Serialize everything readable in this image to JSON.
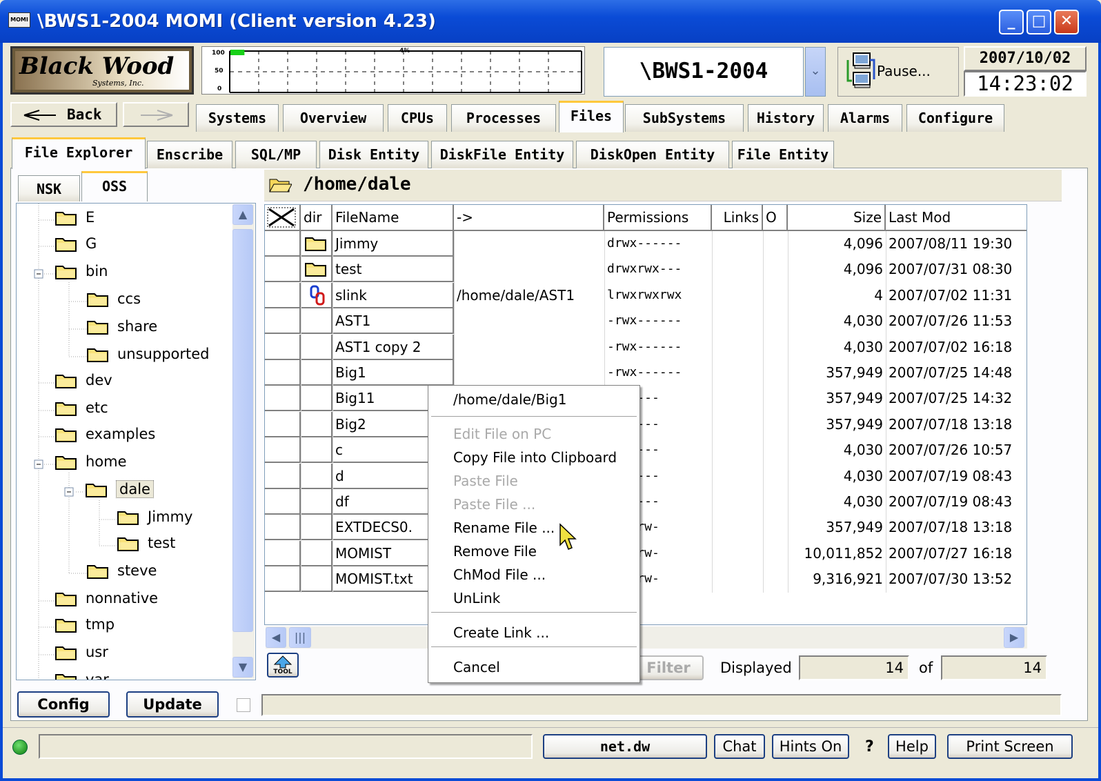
{
  "window": {
    "title": "\\BWS1-2004 MOMI (Client version 4.23)",
    "app_icon": "MOMI"
  },
  "header": {
    "logo_line1": "Black Wood",
    "logo_line2": "Systems, Inc.",
    "graph": {
      "y_ticks": [
        "100",
        "50",
        "0"
      ],
      "percent_label": "4%",
      "progress": 0.04
    },
    "system": "\\BWS1-2004",
    "pause_label": "Pause...",
    "date": "2007/10/02",
    "time": "14:23:02"
  },
  "nav": {
    "back": "Back",
    "tabs": [
      "Systems",
      "Overview",
      "CPUs",
      "Processes",
      "Files",
      "SubSystems",
      "History",
      "Alarms",
      "Configure"
    ],
    "selected_tab": "Files"
  },
  "subtabs": {
    "items": [
      "File Explorer",
      "Enscribe",
      "SQL/MP",
      "Disk Entity",
      "DiskFile Entity",
      "DiskOpen Entity",
      "File Entity"
    ],
    "selected": "File Explorer"
  },
  "tree": {
    "tabs": [
      "NSK",
      "OSS"
    ],
    "selected": "OSS",
    "nodes": [
      "E",
      "G",
      "bin",
      "ccs",
      "share",
      "unsupported",
      "dev",
      "etc",
      "examples",
      "home",
      "dale",
      "Jimmy",
      "test",
      "steve",
      "nonnative",
      "tmp",
      "usr",
      "var"
    ]
  },
  "path": "/home/dale",
  "table": {
    "headers": [
      "dir",
      "FileName",
      "->",
      "Permissions",
      "Links",
      "O",
      "Size",
      "Last Mod"
    ],
    "rows": [
      {
        "dir": "folder",
        "name": "Jimmy",
        "link": "",
        "perm": "drwx------",
        "size": "4,096",
        "mod": "2007/08/11 19:30"
      },
      {
        "dir": "folder",
        "name": "test",
        "link": "",
        "perm": "drwxrwx---",
        "size": "4,096",
        "mod": "2007/07/31 08:30"
      },
      {
        "dir": "link",
        "name": "slink",
        "link": "/home/dale/AST1",
        "perm": "lrwxrwxrwx",
        "size": "4",
        "mod": "2007/07/02 11:31"
      },
      {
        "dir": "",
        "name": "AST1",
        "link": "",
        "perm": "-rwx------",
        "size": "4,030",
        "mod": "2007/07/26 11:53"
      },
      {
        "dir": "",
        "name": "AST1 copy 2",
        "link": "",
        "perm": "-rwx------",
        "size": "4,030",
        "mod": "2007/07/02 16:18"
      },
      {
        "dir": "",
        "name": "Big1",
        "link": "",
        "perm": "-rwx------",
        "size": "357,949",
        "mod": "2007/07/25 14:48"
      },
      {
        "dir": "",
        "name": "Big11",
        "link": "",
        "perm": "x------",
        "size": "357,949",
        "mod": "2007/07/25 14:32"
      },
      {
        "dir": "",
        "name": "Big2",
        "link": "",
        "perm": "x------",
        "size": "357,949",
        "mod": "2007/07/18 13:18"
      },
      {
        "dir": "",
        "name": "c",
        "link": "",
        "perm": "x------",
        "size": "4,030",
        "mod": "2007/07/26 10:57"
      },
      {
        "dir": "",
        "name": "d",
        "link": "",
        "perm": "x------",
        "size": "4,030",
        "mod": "2007/07/19 08:43"
      },
      {
        "dir": "",
        "name": "df",
        "link": "",
        "perm": "x------",
        "size": "4,030",
        "mod": "2007/07/19 08:43"
      },
      {
        "dir": "",
        "name": "EXTDECS0.",
        "link": "",
        "perm": "-rw-rw-",
        "size": "357,949",
        "mod": "2007/07/18 13:18"
      },
      {
        "dir": "",
        "name": "MOMIST",
        "link": "",
        "perm": "-rw-rw-",
        "size": "10,011,852",
        "mod": "2007/07/27 16:18"
      },
      {
        "dir": "",
        "name": "MOMIST.txt",
        "link": "",
        "perm": "-rw-rw-",
        "size": "9,316,921",
        "mod": "2007/07/30 13:52"
      }
    ]
  },
  "context_menu": {
    "title": "/home/dale/Big1",
    "items": [
      {
        "label": "Edit File on PC",
        "disabled": true
      },
      {
        "label": "Copy File into Clipboard",
        "disabled": false
      },
      {
        "label": "Paste File",
        "disabled": true
      },
      {
        "label": "Paste File ...",
        "disabled": true
      },
      {
        "label": "Rename File ...",
        "disabled": false
      },
      {
        "label": "Remove File",
        "disabled": false
      },
      {
        "label": "ChMod File ...",
        "disabled": false
      },
      {
        "label": "UnLink",
        "disabled": false
      },
      {
        "label": "Create Link ...",
        "disabled": false
      },
      {
        "label": "Cancel",
        "disabled": false
      }
    ]
  },
  "footer": {
    "tool_label": "TOOL",
    "filter": "Filter",
    "displayed_label": "Displayed",
    "displayed": "14",
    "of_label": "of",
    "total": "14",
    "config": "Config",
    "update": "Update"
  },
  "status": {
    "host": "net.dw",
    "chat": "Chat",
    "hints": "Hints On",
    "question": "?",
    "help": "Help",
    "print": "Print Screen"
  }
}
